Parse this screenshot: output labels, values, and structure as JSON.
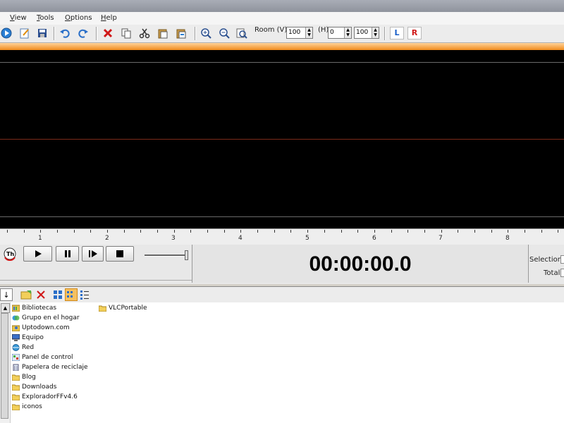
{
  "menu": [
    {
      "id": "view",
      "label": "View"
    },
    {
      "id": "tools",
      "label": "Tools"
    },
    {
      "id": "options",
      "label": "Options"
    },
    {
      "id": "help",
      "label": "Help"
    }
  ],
  "toolbar": {
    "room_v_label": "Room (V)",
    "room_v_value": "100",
    "h_label": "(H)",
    "h_value_1": "0",
    "h_value_2": "100",
    "left_channel": "L",
    "right_channel": "R"
  },
  "ruler": {
    "labels": [
      "1",
      "2",
      "3",
      "4",
      "5",
      "6",
      "7",
      "8"
    ]
  },
  "transport": {
    "time": "00:00:00.0",
    "selection_label": "Selection",
    "total_label": "Total"
  },
  "browser": {
    "tree": [
      {
        "label": "Bibliotecas",
        "icon": "library-icon"
      },
      {
        "label": "Grupo en el hogar",
        "icon": "homegroup-icon"
      },
      {
        "label": "Uptodown.com",
        "icon": "user-folder-icon"
      },
      {
        "label": "Equipo",
        "icon": "computer-icon"
      },
      {
        "label": "Red",
        "icon": "network-icon"
      },
      {
        "label": "Panel de control",
        "icon": "control-panel-icon"
      },
      {
        "label": "Papelera de reciclaje",
        "icon": "recycle-bin-icon"
      },
      {
        "label": "Blog",
        "icon": "folder-icon"
      },
      {
        "label": "Downloads",
        "icon": "folder-icon"
      },
      {
        "label": "ExploradorFFv4.6",
        "icon": "folder-icon"
      },
      {
        "label": "iconos",
        "icon": "folder-icon"
      }
    ],
    "files": [
      {
        "label": "VLCPortable",
        "icon": "folder-icon"
      }
    ]
  },
  "colors": {
    "accent_orange": "#f08a1c",
    "wave_background": "#000000",
    "channel_left": "#1a5fc8",
    "channel_right": "#d01818"
  }
}
